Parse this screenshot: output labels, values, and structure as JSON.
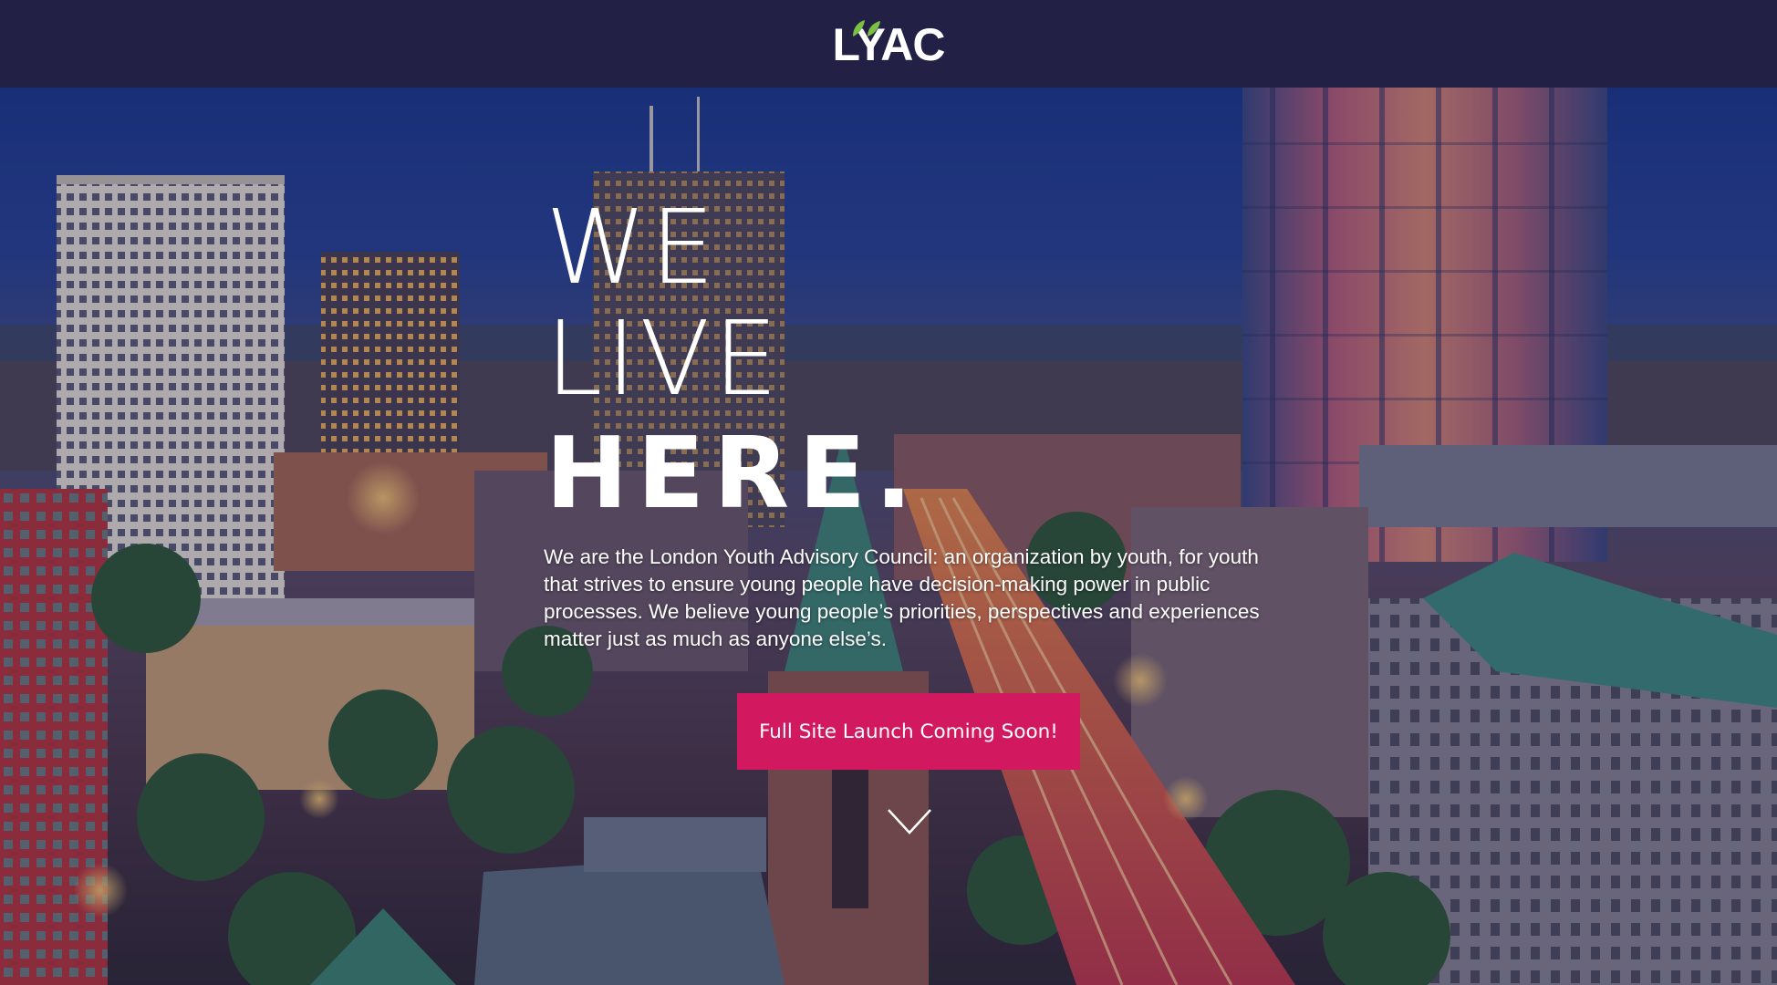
{
  "header": {
    "logo_text": "LYAC",
    "logo_alt": "LYAC"
  },
  "hero": {
    "headline_line1": "WE",
    "headline_line2": "LIVE",
    "headline_line3": "HERE.",
    "intro": "We are the London Youth Advisory Council: an organization by youth, for youth that strives to ensure young people have decision-making power in public processes. We believe young people’s priorities, perspectives and experiences matter just as much as anyone else’s.",
    "cta_label": "Full Site Launch Coming Soon!",
    "scroll_icon": "chevron-down-icon"
  },
  "colors": {
    "topbar": "#222145",
    "cta": "#d2195f",
    "leaf": "#7bc043",
    "text": "#ffffff"
  }
}
